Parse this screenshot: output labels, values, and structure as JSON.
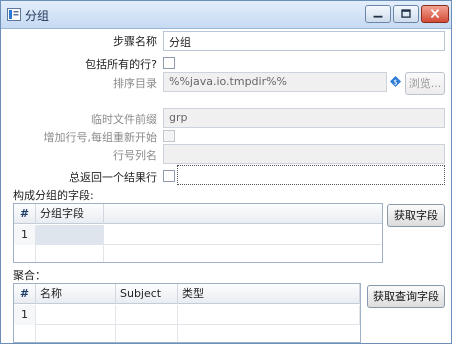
{
  "window": {
    "title": "分组",
    "app_icon": "window-app-icon",
    "controls": [
      "minimize-icon",
      "maximize-icon",
      "close-icon"
    ]
  },
  "form": {
    "step_name_label": "步骤名称",
    "step_name_value": "分组",
    "include_all_rows_label": "包括所有的行?",
    "sort_dir_label": "排序目录",
    "sort_dir_value": "%%java.io.tmpdir%%",
    "browse_button": "浏览...",
    "temp_prefix_label": "临时文件前缀",
    "temp_prefix_value": "grp",
    "add_line_number_label": "增加行号,每组重新开始",
    "line_number_field_label": "行号列名",
    "line_number_field_value": "",
    "always_one_row_label": "总返回一个结果行"
  },
  "group_section": {
    "title": "构成分组的字段:",
    "columns": [
      "#",
      "分组字段"
    ],
    "rows": [
      {
        "num": "1",
        "field": ""
      }
    ],
    "button": "获取字段"
  },
  "aggregate_section": {
    "title": "聚合：",
    "columns": [
      "#",
      "名称",
      "Subject",
      "类型"
    ],
    "rows": [
      {
        "num": "1",
        "name": "",
        "subject": "",
        "type": ""
      }
    ],
    "button": "获取查询字段"
  },
  "colors": {
    "accent": "#2b7ad6",
    "title_bar": "#c6daf2",
    "close_button": "#d24b36"
  }
}
